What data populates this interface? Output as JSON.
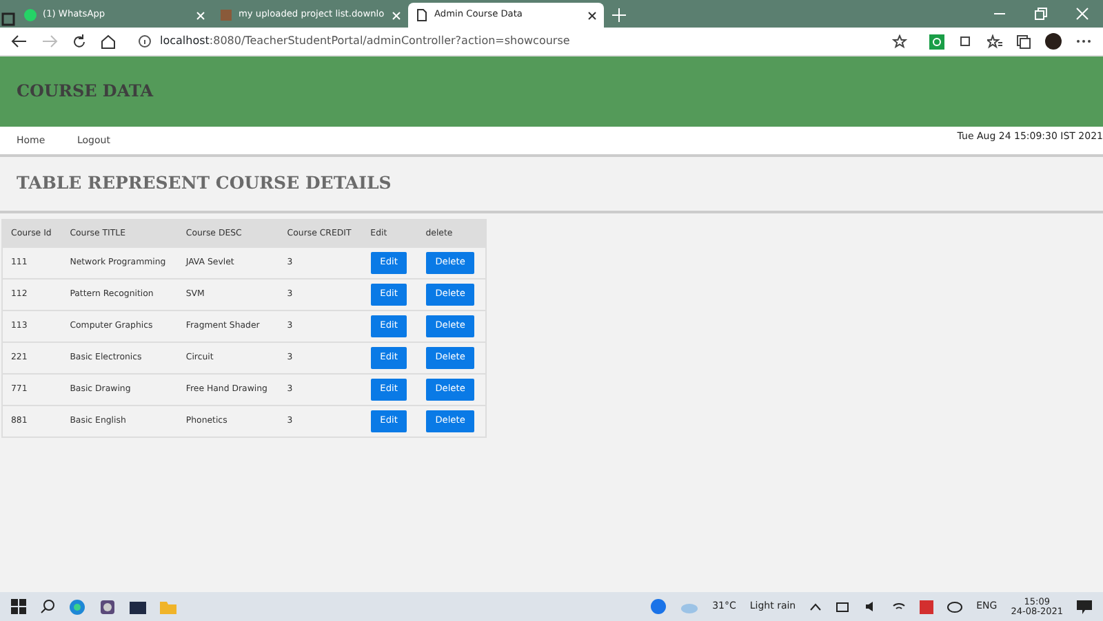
{
  "browser": {
    "tabs": [
      {
        "title": "(1) WhatsApp",
        "selected": false,
        "kind": "chat"
      },
      {
        "title": "my uploaded project list.downlo",
        "selected": false,
        "kind": "image"
      },
      {
        "title": "Admin Course Data",
        "selected": true,
        "kind": "page"
      }
    ],
    "url_host": "localhost",
    "url_rest": ":8080/TeacherStudentPortal/adminController?action=showcourse"
  },
  "header": {
    "title": "COURSE DATA"
  },
  "nav": {
    "links": [
      "Home",
      "Logout"
    ],
    "datetime": "Tue Aug 24 15:09:30 IST 2021"
  },
  "heading": "TABLE REPRESENT COURSE DETAILS",
  "table": {
    "columns": [
      "Course Id",
      "Course TITLE",
      "Course DESC",
      "Course CREDIT",
      "Edit",
      "delete"
    ],
    "rows": [
      {
        "id": "111",
        "title": "Network Programming",
        "desc": "JAVA Sevlet",
        "credit": "3",
        "edit": "Edit",
        "delete": "Delete"
      },
      {
        "id": "112",
        "title": "Pattern Recognition",
        "desc": "SVM",
        "credit": "3",
        "edit": "Edit",
        "delete": "Delete"
      },
      {
        "id": "113",
        "title": "Computer Graphics",
        "desc": "Fragment Shader",
        "credit": "3",
        "edit": "Edit",
        "delete": "Delete"
      },
      {
        "id": "221",
        "title": "Basic Electronics",
        "desc": "Circuit",
        "credit": "3",
        "edit": "Edit",
        "delete": "Delete"
      },
      {
        "id": "771",
        "title": "Basic Drawing",
        "desc": "Free Hand Drawing",
        "credit": "3",
        "edit": "Edit",
        "delete": "Delete"
      },
      {
        "id": "881",
        "title": "Basic English",
        "desc": "Phonetics",
        "credit": "3",
        "edit": "Edit",
        "delete": "Delete"
      }
    ]
  },
  "taskbar": {
    "temperature": "31°C",
    "weather": "Light rain",
    "language": "ENG",
    "time": "15:09",
    "date": "24-08-2021"
  }
}
